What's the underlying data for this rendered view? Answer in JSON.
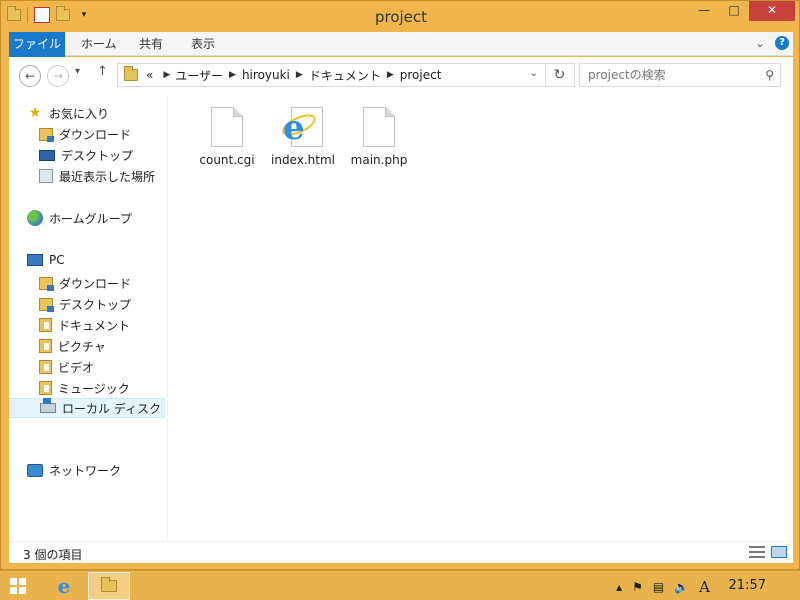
{
  "window": {
    "title": "project"
  },
  "ribbon": {
    "tabs": [
      "ファイル",
      "ホーム",
      "共有",
      "表示"
    ]
  },
  "address": {
    "prefix": "«",
    "crumbs": [
      "ユーザー",
      "hiroyuki",
      "ドキュメント",
      "project"
    ],
    "search_placeholder": "projectの検索"
  },
  "navigation": {
    "favorites_label": "お気に入り",
    "favorites": [
      "ダウンロード",
      "デスクトップ",
      "最近表示した場所"
    ],
    "homegroup_label": "ホームグループ",
    "pc_label": "PC",
    "pc_items": [
      "ダウンロード",
      "デスクトップ",
      "ドキュメント",
      "ピクチャ",
      "ビデオ",
      "ミュージック",
      "ローカル ディスク"
    ],
    "selected_item": "ローカル ディスク",
    "network_label": "ネットワーク"
  },
  "files": [
    {
      "name": "count.cgi",
      "icon": "file-icon"
    },
    {
      "name": "index.html",
      "icon": "ie-html-icon"
    },
    {
      "name": "main.php",
      "icon": "file-icon"
    }
  ],
  "status": {
    "item_count": "3 個の項目"
  },
  "taskbar": {
    "clock": "21:57",
    "ime": "A"
  },
  "colors": {
    "frame": "#f0b64d",
    "file_tab": "#1979ca",
    "close": "#c7403a",
    "taskbar": "#e8b24c"
  }
}
